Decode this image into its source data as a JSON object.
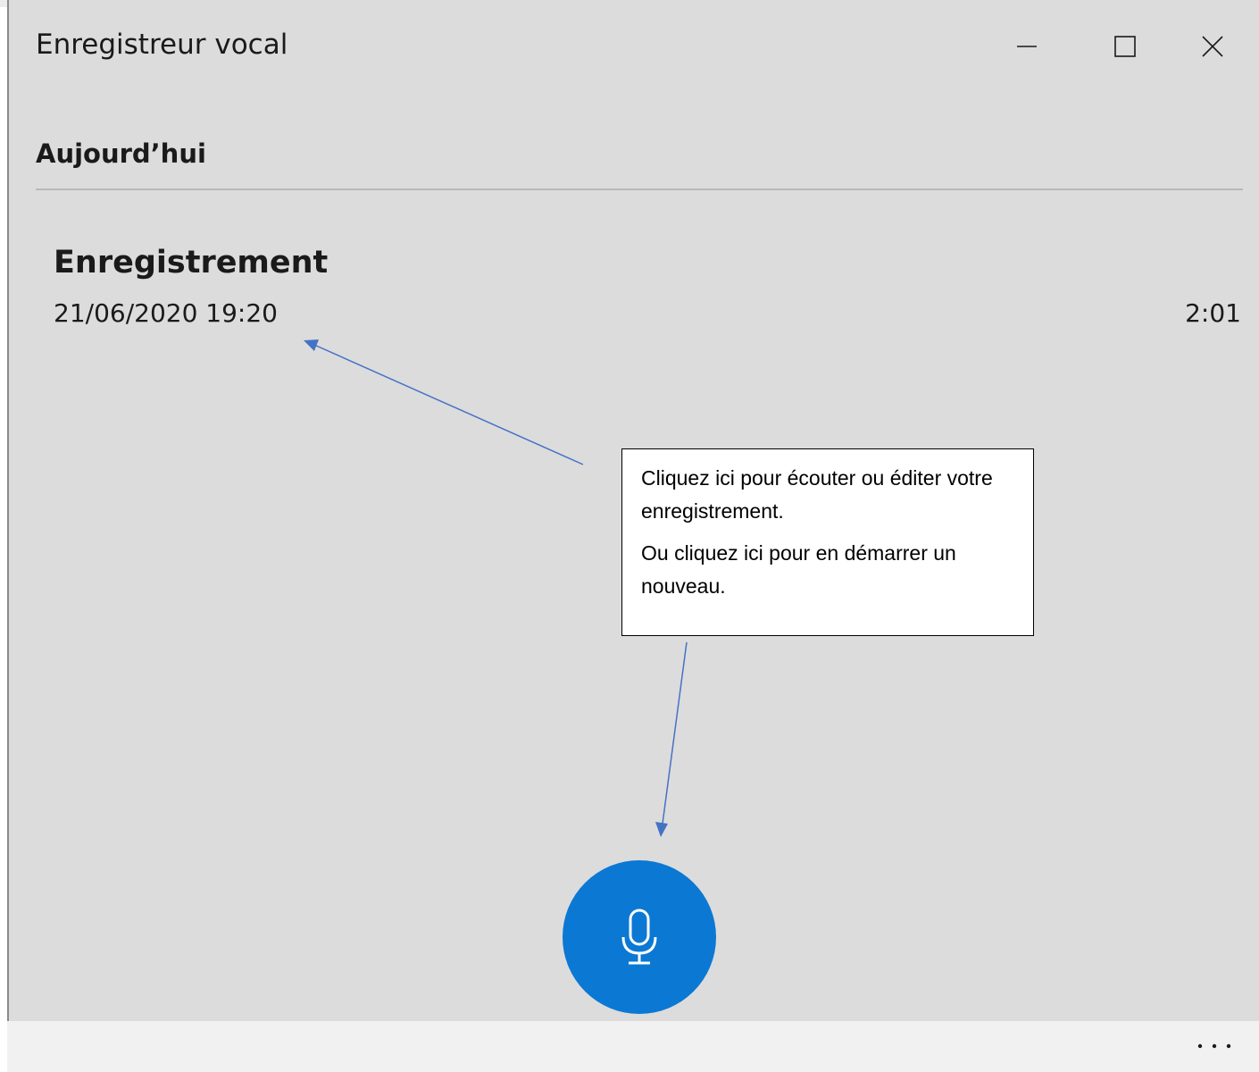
{
  "window": {
    "title": "Enregistreur vocal",
    "controls": {
      "minimize_icon": "minimize-icon",
      "maximize_icon": "maximize-icon",
      "close_icon": "close-icon"
    }
  },
  "list": {
    "section_header": "Aujourd’hui",
    "recordings": [
      {
        "name": "Enregistrement",
        "date": "21/06/2020 19:20",
        "duration": "2:01"
      }
    ]
  },
  "callout": {
    "line1": "Cliquez ici pour écouter ou éditer votre enregistrement.",
    "line2": "Ou cliquez ici pour en démarrer un nouveau."
  },
  "record_button": {
    "icon": "microphone-icon"
  },
  "bottom_bar": {
    "more_icon": "more-options-icon"
  },
  "colors": {
    "window_bg": "#dcdcdc",
    "accent": "#0b78d4",
    "bottom_bar_bg": "#f1f1f1",
    "annotation_arrow": "#4472c4"
  }
}
